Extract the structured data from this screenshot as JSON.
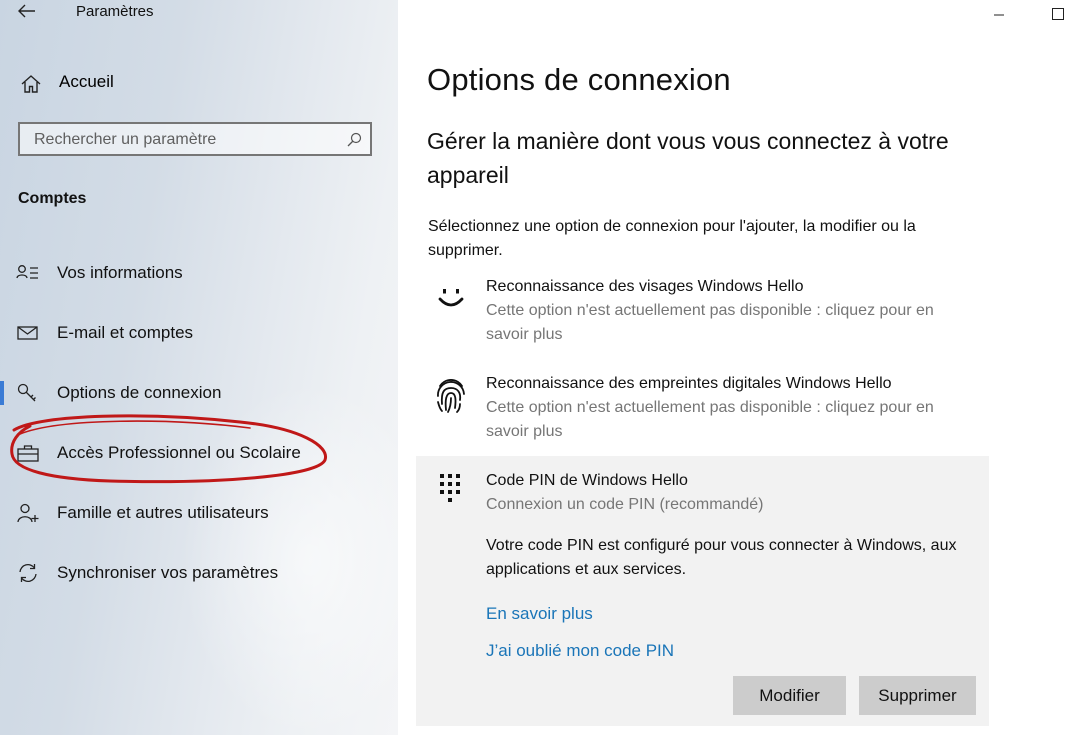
{
  "app": {
    "title": "Paramètres"
  },
  "sidebar": {
    "home_label": "Accueil",
    "search_placeholder": "Rechercher un paramètre",
    "section_title": "Comptes",
    "items": [
      {
        "label": "Vos informations",
        "icon": "person-list-icon"
      },
      {
        "label": "E-mail et comptes",
        "icon": "mail-icon"
      },
      {
        "label": "Options de connexion",
        "icon": "key-icon",
        "selected": true
      },
      {
        "label": "Accès Professionnel ou Scolaire",
        "icon": "briefcase-icon"
      },
      {
        "label": "Famille et autres utilisateurs",
        "icon": "add-person-icon"
      },
      {
        "label": "Synchroniser vos paramètres",
        "icon": "sync-icon"
      }
    ],
    "annotation_color": "#c01818"
  },
  "main": {
    "title": "Options de connexion",
    "subtitle": "Gérer la manière dont vous vous connectez à votre appareil",
    "instructions": "Sélectionnez une option de connexion pour l'ajouter, la modifier ou la supprimer.",
    "options": [
      {
        "title": "Reconnaissance des visages Windows Hello",
        "desc": "Cette option n'est actuellement pas disponible : cliquez pour en savoir plus",
        "icon": "face-smile-icon"
      },
      {
        "title": "Reconnaissance des empreintes digitales Windows Hello",
        "desc": "Cette option n'est actuellement pas disponible : cliquez pour en savoir plus",
        "icon": "fingerprint-icon"
      }
    ],
    "pin": {
      "title": "Code PIN de Windows Hello",
      "subtitle": "Connexion un code PIN (recommandé)",
      "body": "Votre code PIN est configuré pour vous connecter à Windows, aux applications et aux services.",
      "link_learn": "En savoir plus",
      "link_forgot": "J’ai oublié mon code PIN",
      "btn_modify": "Modifier",
      "btn_remove": "Supprimer",
      "icon": "keypad-icon"
    }
  },
  "colors": {
    "accent": "#1a75b8",
    "button_bg": "#cccccc",
    "panel_bg": "#f2f2f2",
    "muted_text": "#767676"
  }
}
